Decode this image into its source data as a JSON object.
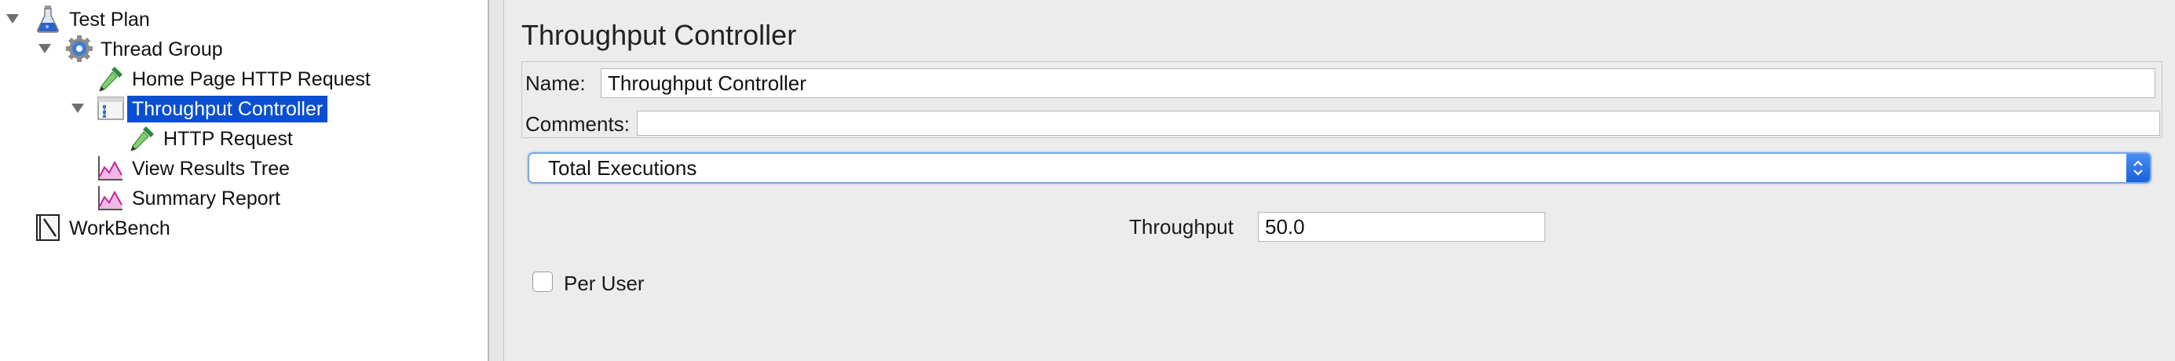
{
  "tree": {
    "items": [
      {
        "label": "Test Plan",
        "icon": "flask-icon",
        "expanded": true,
        "selected": false
      },
      {
        "label": "Thread Group",
        "icon": "gear-icon",
        "expanded": true,
        "selected": false
      },
      {
        "label": "Home Page HTTP Request",
        "icon": "pipette-icon",
        "selected": false
      },
      {
        "label": "Throughput Controller",
        "icon": "controller-icon",
        "expanded": true,
        "selected": true
      },
      {
        "label": "HTTP Request",
        "icon": "pipette-icon",
        "selected": false
      },
      {
        "label": "View Results Tree",
        "icon": "graph-icon",
        "selected": false
      },
      {
        "label": "Summary Report",
        "icon": "graph-icon",
        "selected": false
      },
      {
        "label": "WorkBench",
        "icon": "notebook-icon",
        "selected": false
      }
    ]
  },
  "editor": {
    "title": "Throughput Controller",
    "name_label": "Name:",
    "name_value": "Throughput Controller",
    "comments_label": "Comments:",
    "comments_value": "",
    "mode_value": "Total Executions",
    "throughput_label": "Throughput",
    "throughput_value": "50.0",
    "per_user_label": "Per User",
    "per_user_checked": false
  },
  "colors": {
    "selection": "#0b4fd1",
    "select_accent": "#1a62dc"
  }
}
